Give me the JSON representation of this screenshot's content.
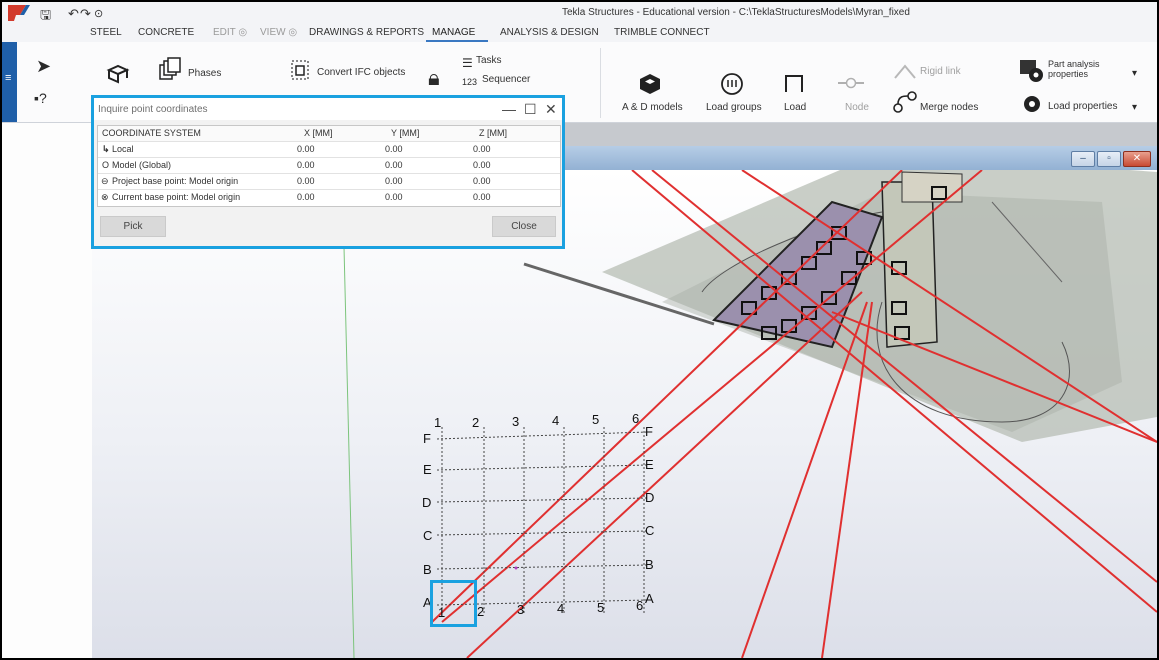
{
  "app": {
    "title": "Tekla Structures - Educational version - C:\\TeklaStructuresModels\\Myran_fixed",
    "quick_access": {
      "save": "🖫",
      "undo": "↶",
      "redo": "↷",
      "history": "⊙"
    }
  },
  "menu_tabs": [
    {
      "label": "STEEL",
      "state": "normal"
    },
    {
      "label": "CONCRETE",
      "state": "normal"
    },
    {
      "label": "EDIT",
      "state": "disabled"
    },
    {
      "label": "VIEW",
      "state": "disabled"
    },
    {
      "label": "DRAWINGS & REPORTS",
      "state": "normal"
    },
    {
      "label": "MANAGE",
      "state": "active"
    },
    {
      "label": "ANALYSIS & DESIGN",
      "state": "normal"
    },
    {
      "label": "TRIMBLE CONNECT",
      "state": "normal"
    }
  ],
  "ribbon": {
    "phases": "Phases",
    "convert_ifc": "Convert IFC objects",
    "tasks": "Tasks",
    "sequencer": "Sequencer",
    "ad_models": "A & D models",
    "load_groups": "Load groups",
    "load": "Load",
    "node": "Node",
    "rigid_link": "Rigid link",
    "merge_nodes": "Merge nodes",
    "part_analysis_properties": "Part analysis properties",
    "load_properties": "Load properties"
  },
  "dialog": {
    "title": "Inquire point coordinates",
    "columns": [
      "COORDINATE SYSTEM",
      "X [MM]",
      "Y [MM]",
      "Z [MM]"
    ],
    "rows": [
      {
        "icon": "↳",
        "name": "Local",
        "x": "0.00",
        "y": "0.00",
        "z": "0.00"
      },
      {
        "icon": "O",
        "name": "Model (Global)",
        "x": "0.00",
        "y": "0.00",
        "z": "0.00"
      },
      {
        "icon": "⊖",
        "name": "Project base point: Model origin",
        "x": "0.00",
        "y": "0.00",
        "z": "0.00"
      },
      {
        "icon": "⊗",
        "name": "Current base point: Model origin",
        "x": "0.00",
        "y": "0.00",
        "z": "0.00"
      }
    ],
    "pick_button": "Pick",
    "close_button": "Close"
  },
  "grid_labels": {
    "top_numbers": [
      "1",
      "2",
      "3",
      "4",
      "5",
      "6"
    ],
    "bottom_numbers": [
      "1",
      "2",
      "3",
      "4",
      "5",
      "6"
    ],
    "left_letters": [
      "F",
      "E",
      "D",
      "C",
      "B",
      "A"
    ],
    "right_letters": [
      "F",
      "E",
      "D",
      "C",
      "B",
      "A"
    ]
  },
  "colors": {
    "accent": "#1aa1e0",
    "grid_red": "#e03030",
    "ribbon_blue": "#1f5fa8"
  }
}
